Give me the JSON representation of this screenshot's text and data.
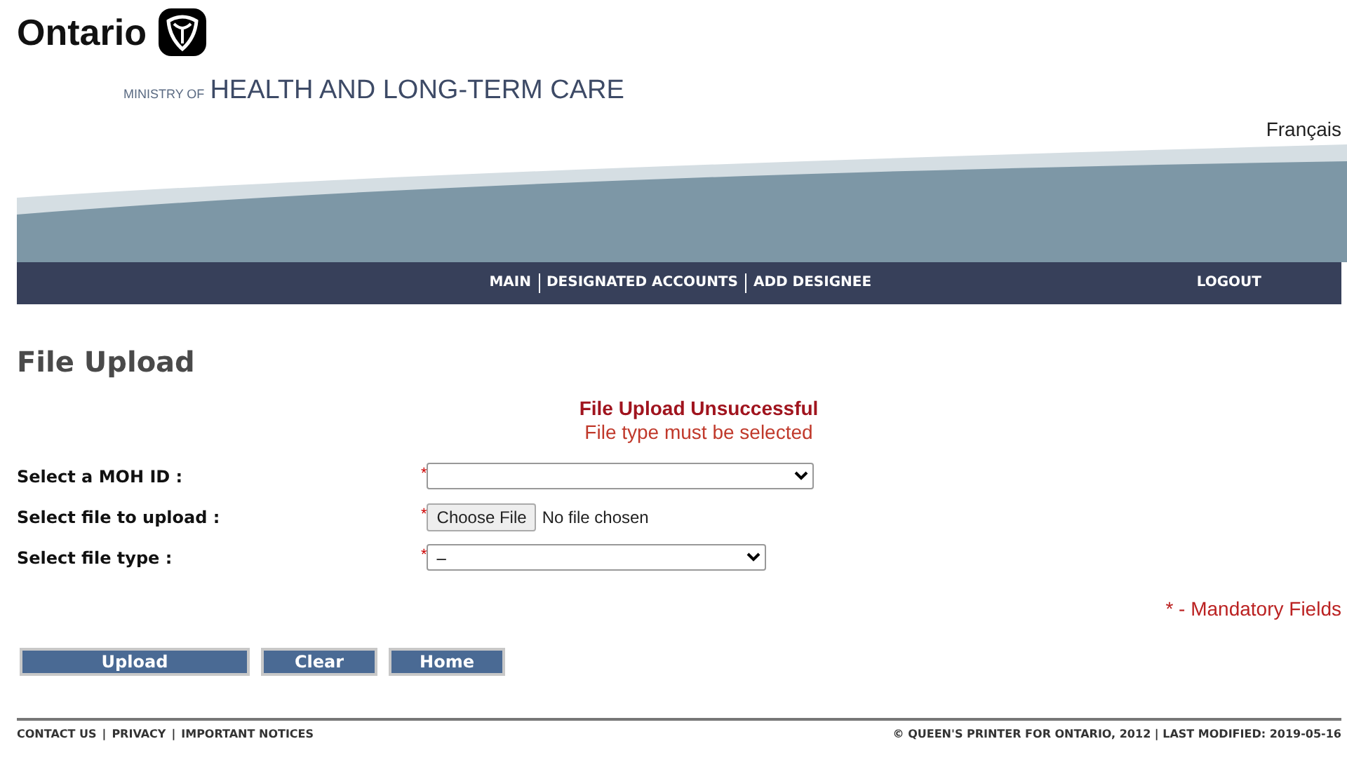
{
  "header": {
    "logo_text": "Ontario",
    "ministry_prefix": "MINISTRY OF",
    "ministry_name": "HEALTH AND LONG-TERM CARE",
    "language_link": "Français"
  },
  "nav": {
    "items": [
      "MAIN",
      "DESIGNATED ACCOUNTS",
      "ADD DESIGNEE"
    ],
    "logout": "LOGOUT"
  },
  "page_title": "File Upload",
  "message": {
    "title": "File Upload Unsuccessful",
    "detail": "File type must be selected"
  },
  "fields": [
    {
      "kind": "select",
      "label": "Select a MOH ID :",
      "required_mark": "*"
    },
    {
      "kind": "file",
      "label": "Select file to upload :",
      "required_mark": "*",
      "button": "Choose File",
      "status": "No file chosen"
    },
    {
      "kind": "select",
      "label": "Select file type :",
      "required_mark": "*",
      "value": "–"
    }
  ],
  "mandatory_note": "* - Mandatory Fields",
  "buttons": [
    {
      "label": "Upload"
    },
    {
      "label": "Clear"
    },
    {
      "label": "Home"
    }
  ],
  "footer": {
    "links": [
      "CONTACT US",
      "PRIVACY",
      "IMPORTANT NOTICES"
    ],
    "separator": "|",
    "copyright": "© QUEEN'S PRINTER FOR ONTARIO, 2012 | LAST MODIFIED: 2019-05-16"
  }
}
